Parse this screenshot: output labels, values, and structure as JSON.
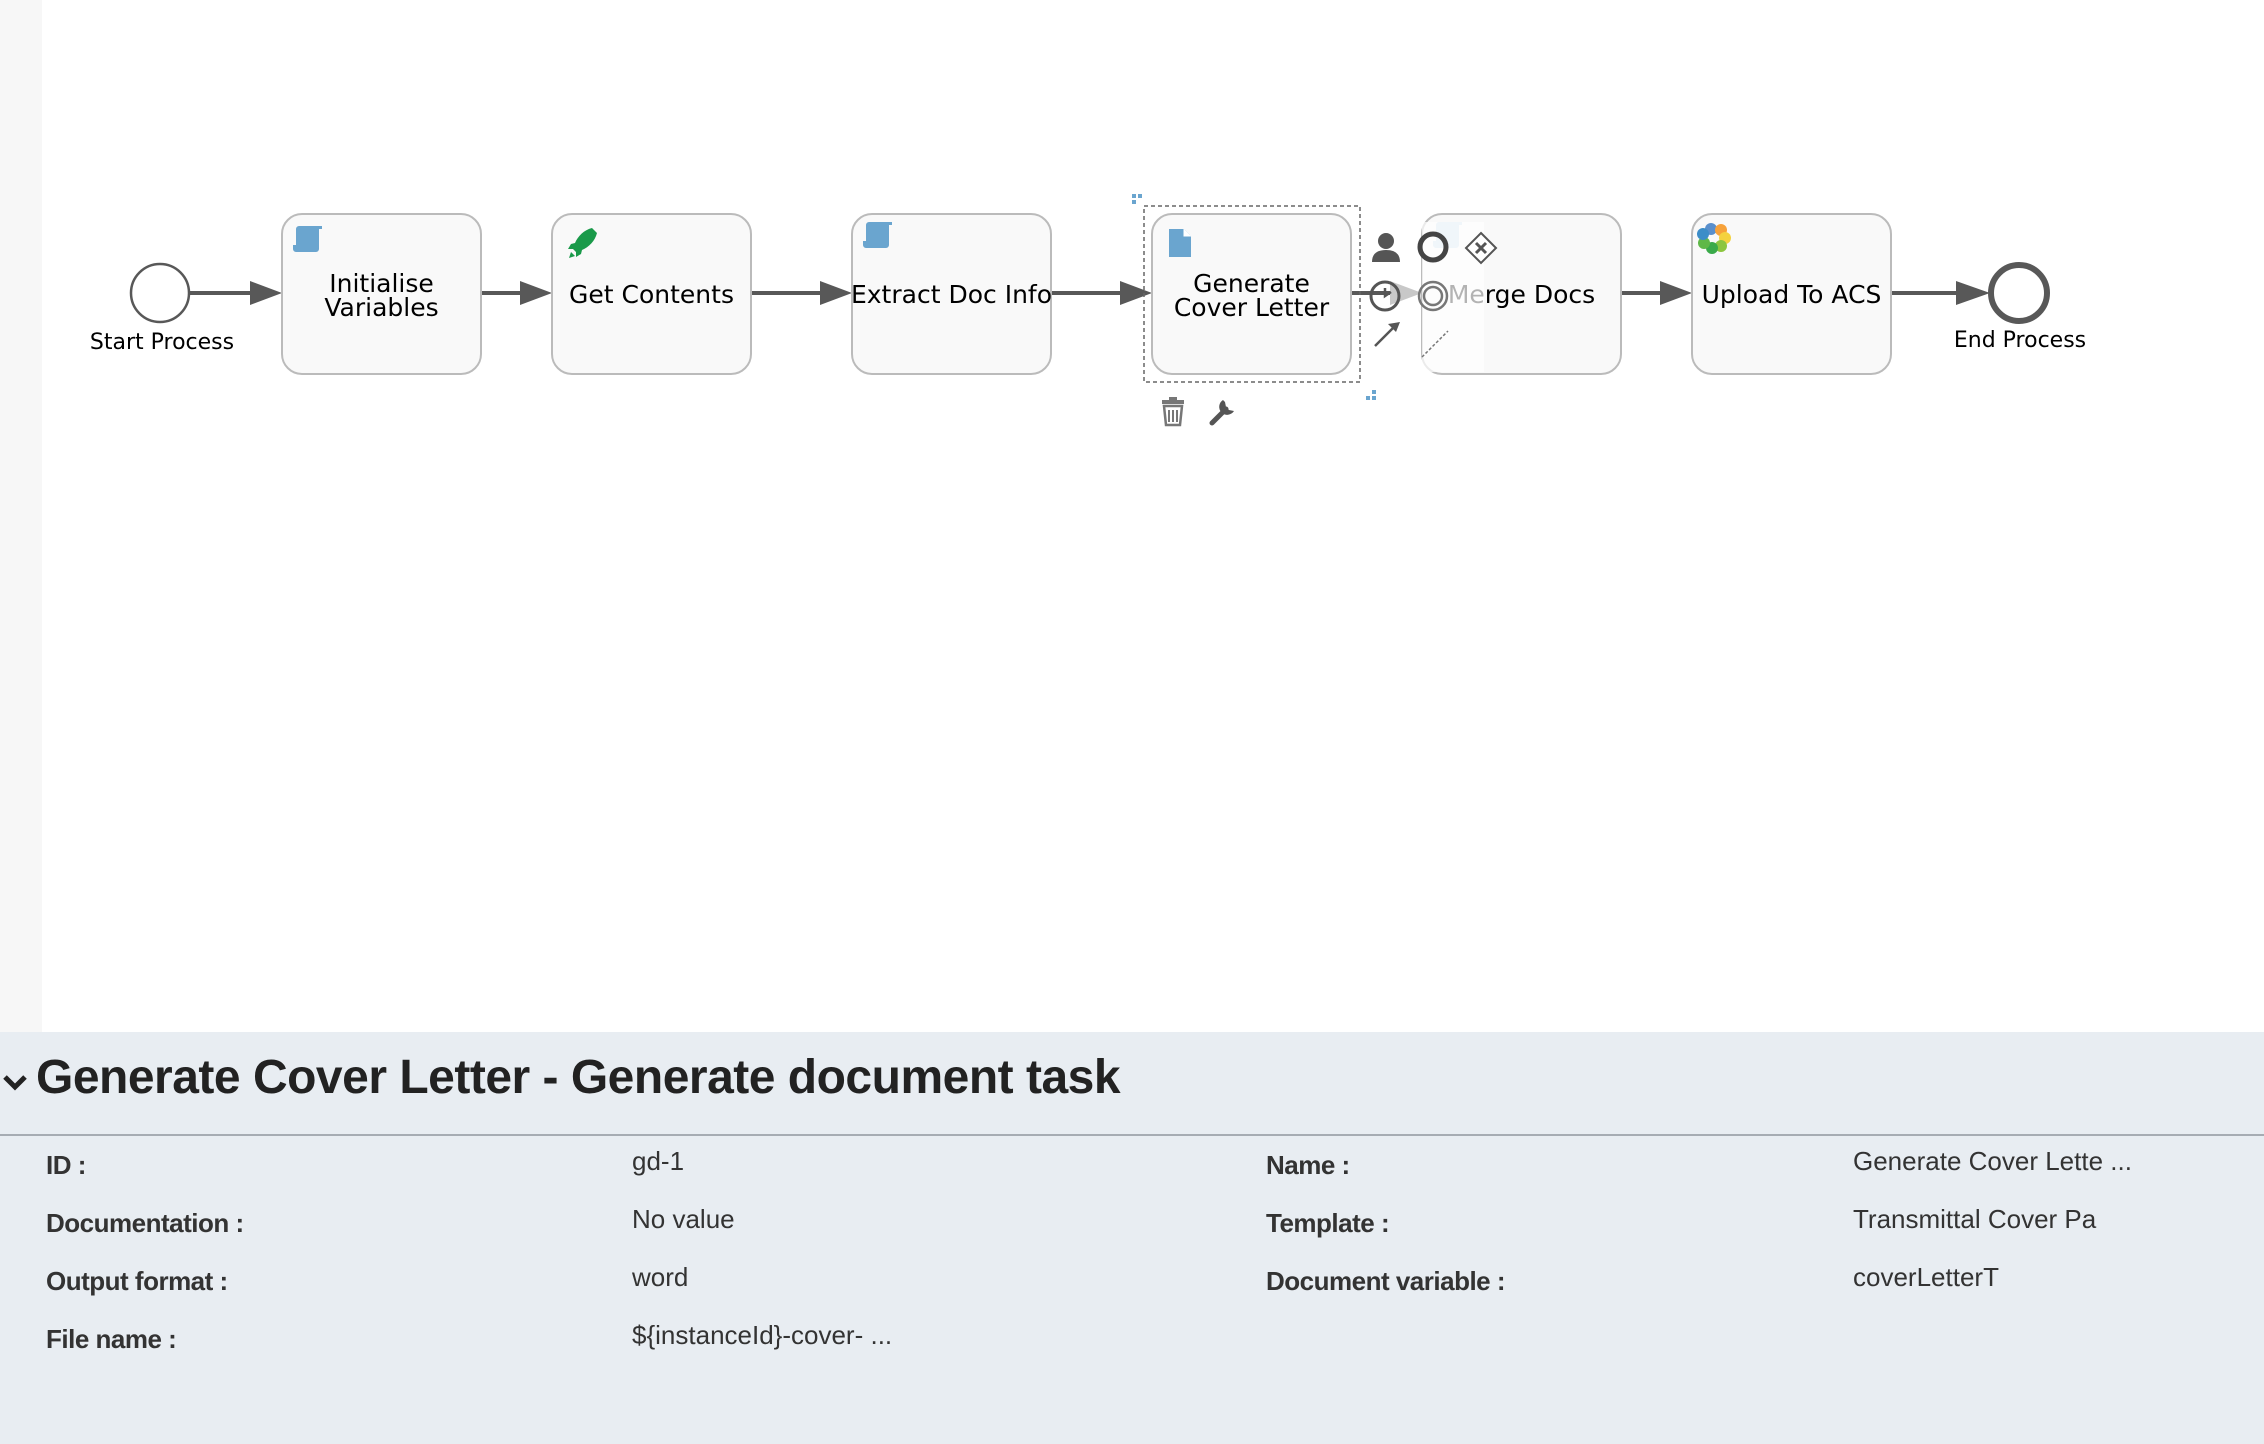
{
  "diagram": {
    "start_event": {
      "label": "Start Process"
    },
    "end_event": {
      "label": "End Process"
    },
    "tasks": [
      {
        "id": "initialise-variables",
        "label_lines": [
          "Initialise",
          "Variables"
        ],
        "icon": "script-icon"
      },
      {
        "id": "get-contents",
        "label_lines": [
          "Get Contents"
        ],
        "icon": "rocket-icon"
      },
      {
        "id": "extract-doc-info",
        "label_lines": [
          "Extract Doc Info"
        ],
        "icon": "script-icon"
      },
      {
        "id": "generate-cover-letter",
        "label_lines": [
          "Generate",
          "Cover Letter"
        ],
        "icon": "document-icon",
        "selected": true
      },
      {
        "id": "merge-docs",
        "label_lines": [
          "Merge Docs"
        ],
        "icon": "script-icon"
      },
      {
        "id": "upload-to-acs",
        "label_lines": [
          "Upload To ACS"
        ],
        "icon": "alfresco-icon"
      }
    ],
    "context_pad": [
      "user-task-icon",
      "end-event-icon",
      "gateway-icon",
      "timer-event-icon",
      "intermediate-event-icon",
      "sequence-flow-icon",
      "association-icon"
    ],
    "selection_tools": [
      "delete-icon",
      "wrench-icon"
    ],
    "colors": {
      "task_fill": "#f9f9f9",
      "task_stroke": "#bbbbbb",
      "flow": "#585858",
      "icon_blue": "#6aa5cf",
      "rocket_green": "#1a9a4a"
    }
  },
  "panel": {
    "title": "Generate Cover Letter - Generate document task",
    "properties_left": [
      {
        "label": "ID :",
        "value": "gd-1"
      },
      {
        "label": "Documentation :",
        "value": "No value"
      },
      {
        "label": "Output format :",
        "value": "word"
      },
      {
        "label": "File name :",
        "value": "${instanceId}-cover- ..."
      }
    ],
    "properties_right": [
      {
        "label": "Name :",
        "value": "Generate Cover Lette ..."
      },
      {
        "label": "Template :",
        "value": "Transmittal Cover Pa"
      },
      {
        "label": "Document variable :",
        "value": "coverLetterT"
      }
    ]
  }
}
